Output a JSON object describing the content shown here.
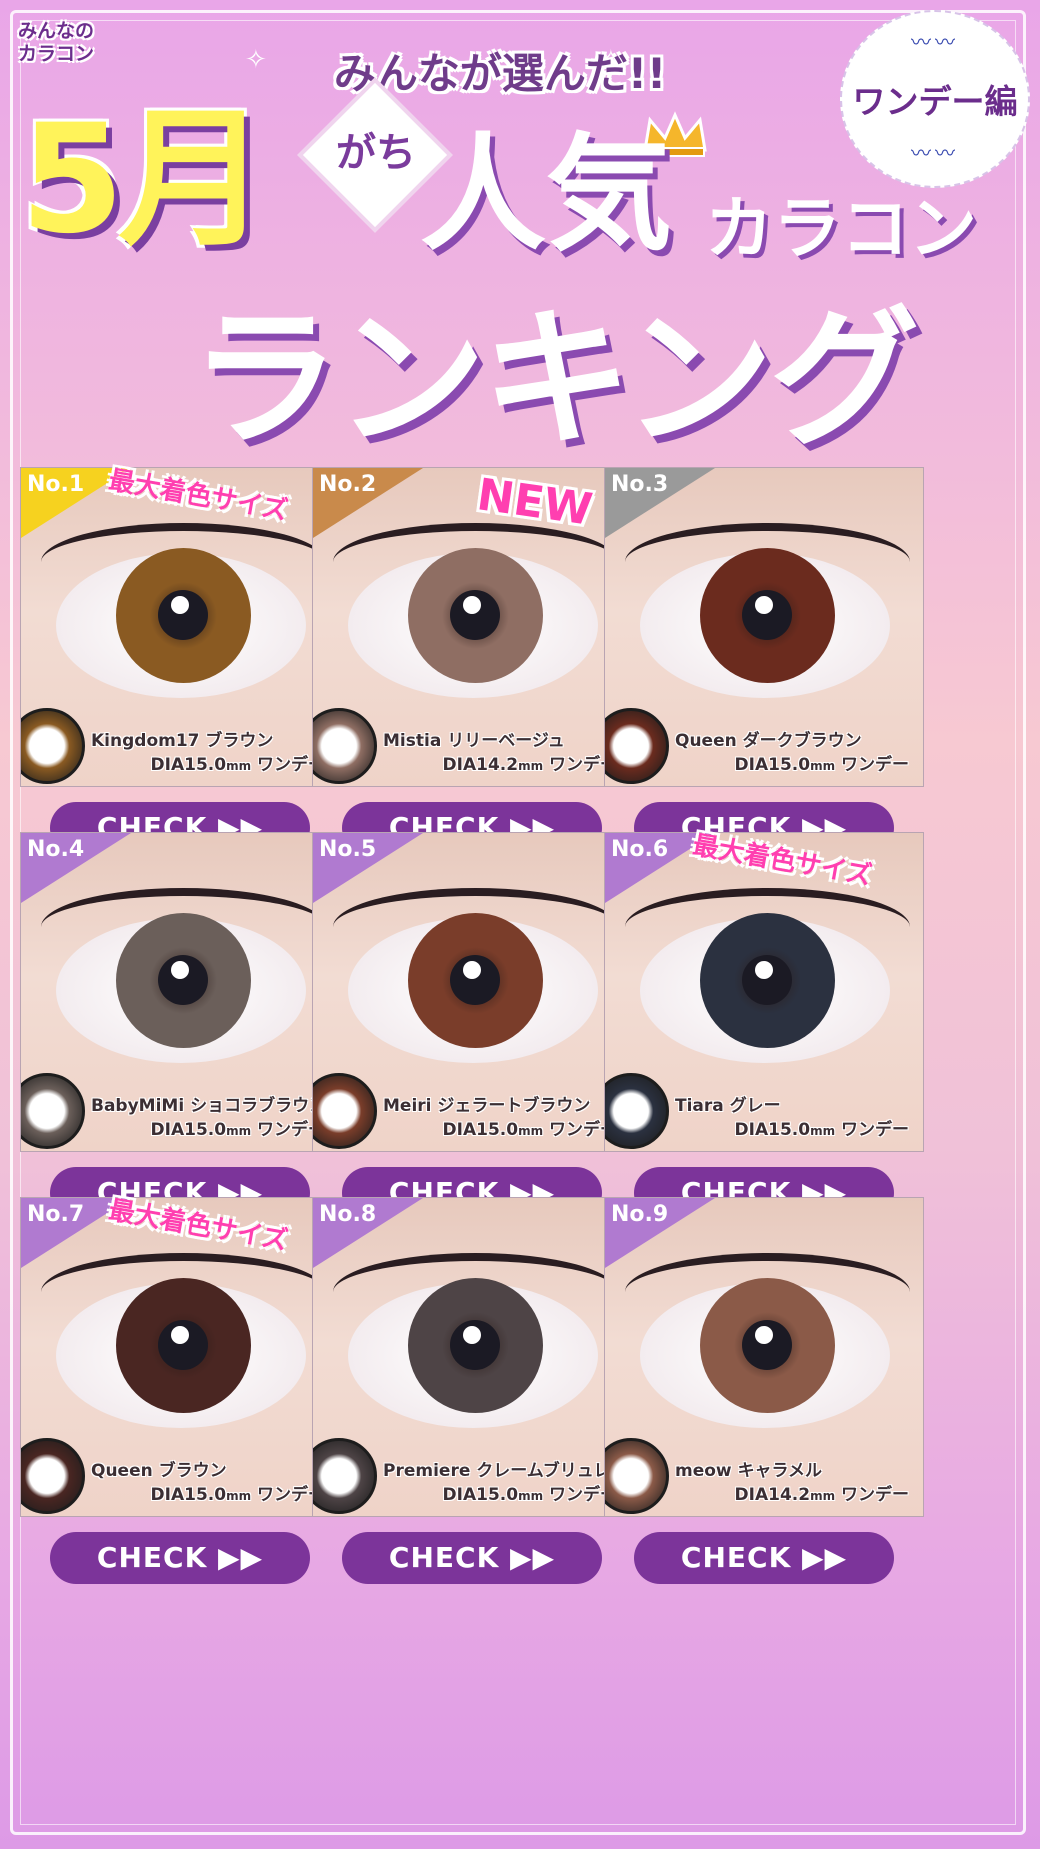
{
  "header": {
    "logo": "みんなのカラコン",
    "subtitle": "みんなが選んだ!!",
    "badge": "ワンデー編",
    "month": "5月",
    "gachi": "がち",
    "popular": "人気",
    "karakon": "カラコン",
    "ranking": "ランキング"
  },
  "items": [
    {
      "rank": "No.1",
      "tag": "最大着色サイズ",
      "name": "Kingdom17",
      "color": "ブラウン",
      "dia": "DIA15.0",
      "unit": "mm",
      "type": "ワンデー",
      "cta": "CHECK ▶▶",
      "rank_color": "#f6d21f",
      "iris": "#8a5a22"
    },
    {
      "rank": "No.2",
      "tag": "NEW",
      "name": "Mistia",
      "color": "リリーベージュ",
      "dia": "DIA14.2",
      "unit": "mm",
      "type": "ワンデー",
      "cta": "CHECK ▶▶",
      "rank_color": "#c98a4b",
      "iris": "#8f6e63"
    },
    {
      "rank": "No.3",
      "tag": "",
      "name": "Queen",
      "color": "ダークブラウン",
      "dia": "DIA15.0",
      "unit": "mm",
      "type": "ワンデー",
      "cta": "CHECK ▶▶",
      "rank_color": "#9a9a9a",
      "iris": "#6b2b1e"
    },
    {
      "rank": "No.4",
      "tag": "",
      "name": "BabyMiMi",
      "color": "ショコラブラウン",
      "dia": "DIA15.0",
      "unit": "mm",
      "type": "ワンデー",
      "cta": "CHECK ▶▶",
      "rank_color": "#b07ad0",
      "iris": "#6b5f5a"
    },
    {
      "rank": "No.5",
      "tag": "",
      "name": "Meiri",
      "color": "ジェラートブラウン",
      "dia": "DIA15.0",
      "unit": "mm",
      "type": "ワンデー",
      "cta": "CHECK ▶▶",
      "rank_color": "#b07ad0",
      "iris": "#7a3d2a"
    },
    {
      "rank": "No.6",
      "tag": "最大着色サイズ",
      "name": "Tiara",
      "color": "グレー",
      "dia": "DIA15.0",
      "unit": "mm",
      "type": "ワンデー",
      "cta": "CHECK ▶▶",
      "rank_color": "#b07ad0",
      "iris": "#2b3140"
    },
    {
      "rank": "No.7",
      "tag": "最大着色サイズ",
      "name": "Queen",
      "color": "ブラウン",
      "dia": "DIA15.0",
      "unit": "mm",
      "type": "ワンデー",
      "cta": "CHECK ▶▶",
      "rank_color": "#b07ad0",
      "iris": "#4a2622"
    },
    {
      "rank": "No.8",
      "tag": "",
      "name": "Premiere",
      "color": "クレームブリュレ",
      "dia": "DIA15.0",
      "unit": "mm",
      "type": "ワンデー",
      "cta": "CHECK ▶▶",
      "rank_color": "#b07ad0",
      "iris": "#4e4446"
    },
    {
      "rank": "No.9",
      "tag": "",
      "name": "meow",
      "color": "キャラメル",
      "dia": "DIA14.2",
      "unit": "mm",
      "type": "ワンデー",
      "cta": "CHECK ▶▶",
      "rank_color": "#b07ad0",
      "iris": "#8b5a48"
    }
  ]
}
